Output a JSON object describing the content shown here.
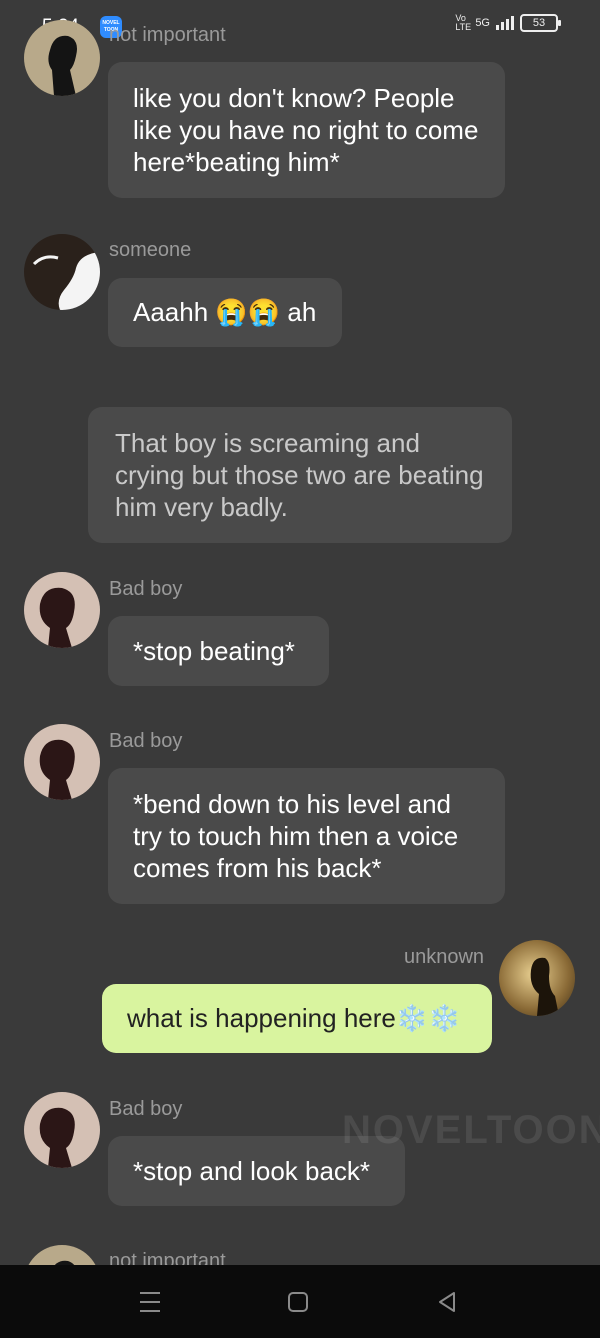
{
  "status_bar": {
    "time": "5:24",
    "app_badge": "NOVEL TOON",
    "volte": "Vo LTE",
    "network": "5G",
    "battery": "53"
  },
  "messages": [
    {
      "name": "not important",
      "text": "like you don't know? People like you have no right to come here*beating him*"
    },
    {
      "name": "someone",
      "text": "Aaahh 😭😭 ah"
    },
    {
      "narration": "That boy is screaming and crying but those two are beating him very badly."
    },
    {
      "name": "Bad boy",
      "text": "*stop beating*"
    },
    {
      "name": "Bad boy",
      "text": "*bend down to his level and try to touch him then a voice comes from his back*"
    },
    {
      "name": "unknown",
      "text": "what is happening here❄️❄️"
    },
    {
      "name": "Bad boy",
      "text": "*stop and look back*"
    },
    {
      "name": "not important"
    }
  ],
  "watermark": "NOVELTOON",
  "colors": {
    "background": "#3a3a3a",
    "bubble": "#4a4a4a",
    "my_bubble": "#d9f49f",
    "nav_bar": "#0b0b0b"
  },
  "nav_icons": [
    "menu-icon",
    "home-icon",
    "back-icon"
  ]
}
